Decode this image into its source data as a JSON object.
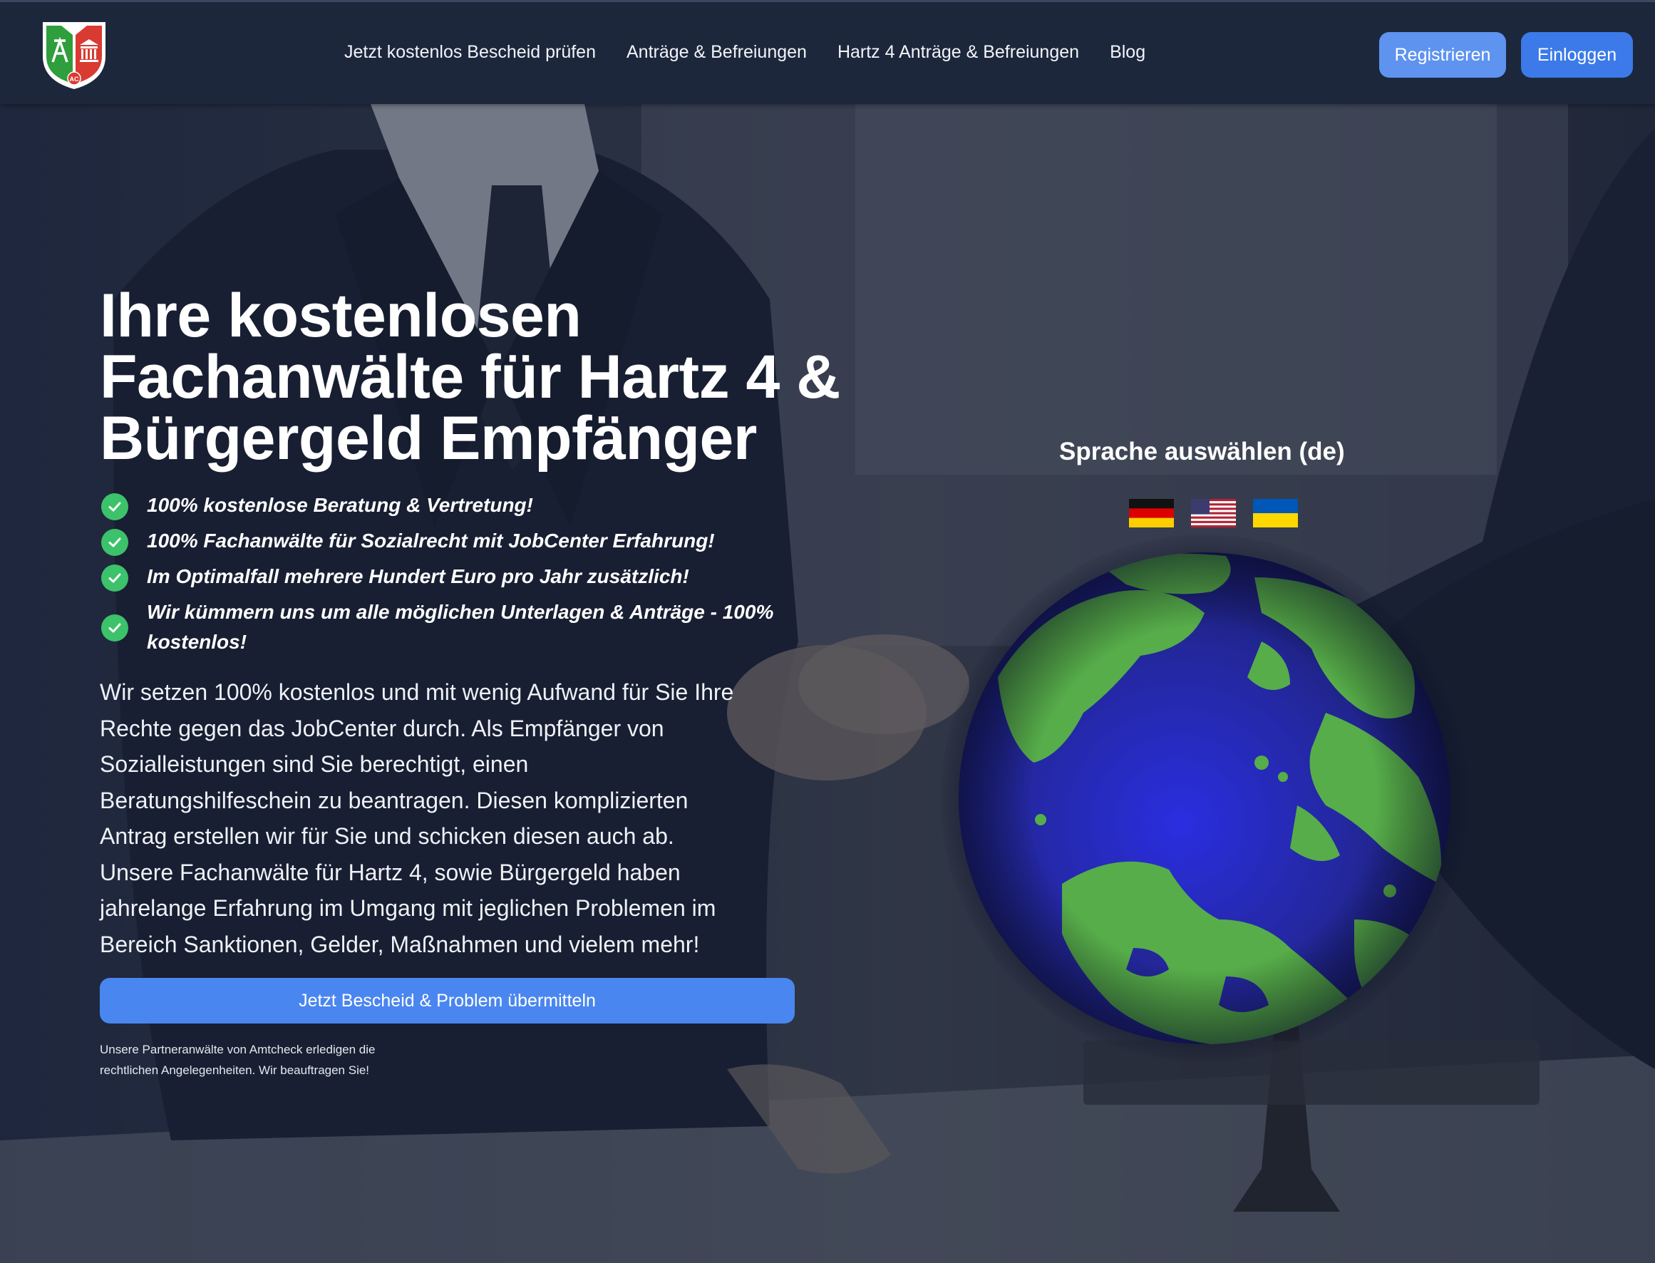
{
  "nav": {
    "links": [
      "Jetzt kostenlos Bescheid prüfen",
      "Anträge & Befreiungen",
      "Hartz 4 Anträge & Befreiungen",
      "Blog"
    ],
    "register": "Registrieren",
    "login": "Einloggen",
    "logo_text": "AC"
  },
  "hero": {
    "headline": "Ihre kostenlosen Fachanwälte für Hartz 4 & Bürgergeld Empfänger",
    "features": [
      "100% kostenlose Beratung & Vertretung!",
      "100% Fachanwälte für Sozialrecht mit JobCenter Erfahrung!",
      "Im Optimalfall mehrere Hundert Euro pro Jahr zusätzlich!",
      "Wir kümmern uns um alle möglichen Unterlagen & Anträge - 100% kostenlos!"
    ],
    "lead": "Wir setzen 100% kostenlos und mit wenig Aufwand für Sie Ihre Rechte gegen das JobCenter durch. Als Empfänger von Sozialleistungen sind Sie berechtigt, einen Beratungshilfeschein zu beantragen. Diesen komplizierten Antrag erstellen wir für Sie und schicken diesen auch ab. Unsere Fachanwälte für Hartz 4, sowie Bürgergeld haben jahrelange Erfahrung im Umgang mit jeglichen Problemen im Bereich Sanktionen, Gelder, Maßnahmen und vielem mehr!",
    "cta": "Jetzt Bescheid & Problem übermitteln",
    "disclaimer": "Unsere Partneranwälte von Amtcheck erledigen die rechtlichen Angelegenheiten. Wir beauftragen Sie!"
  },
  "language": {
    "title": "Sprache auswählen (de)",
    "flags": [
      "flag-germany-icon",
      "flag-usa-icon",
      "flag-ukraine-icon"
    ]
  },
  "colors": {
    "navbar": "#1c273c",
    "button_primary": "#4a86ef",
    "button_register": "#5e93f0",
    "check_green": "#3cc26a",
    "globe_ocean": "#2a2fb0",
    "globe_land": "#5bb04a"
  },
  "icons": {
    "logo": "shield-logo-icon",
    "feature_check": "check-circle-icon",
    "globe": "globe-icon"
  }
}
